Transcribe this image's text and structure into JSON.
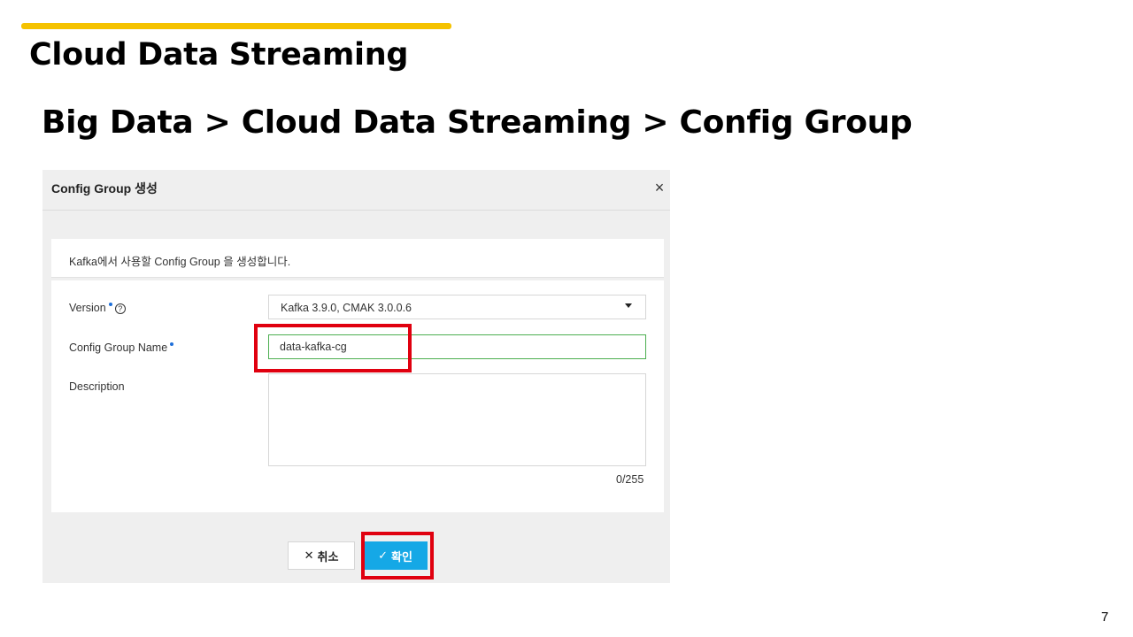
{
  "slide": {
    "title": "Cloud Data Streaming",
    "breadcrumb": "Big Data > Cloud Data Streaming > Config Group",
    "page_number": "7"
  },
  "modal": {
    "title": "Config Group 생성",
    "close_icon": "close-icon",
    "info_text": "Kafka에서 사용할 Config Group 을 생성합니다.",
    "fields": {
      "version": {
        "label": "Version",
        "selected": "Kafka 3.9.0, CMAK 3.0.0.6",
        "icon": "help-icon"
      },
      "config_group_name": {
        "label": "Config Group Name",
        "value": "data-kafka-cg"
      },
      "description": {
        "label": "Description",
        "value": "",
        "counter": "0/255"
      }
    },
    "buttons": {
      "cancel_label": "취소",
      "confirm_label": "확인"
    }
  },
  "colors": {
    "accent_bar": "#f5c200",
    "highlight": "#e0000f",
    "confirm_button": "#15a8e6",
    "required_dot": "#1e6fd9",
    "input_focus_border": "#4caf50"
  }
}
